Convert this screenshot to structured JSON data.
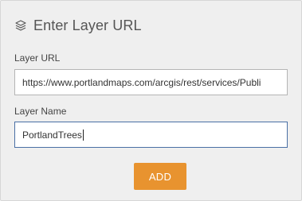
{
  "header": {
    "title": "Enter Layer URL",
    "icon": "layers-icon"
  },
  "form": {
    "url_label": "Layer URL",
    "url_value": "https://www.portlandmaps.com/arcgis/rest/services/Publi",
    "name_label": "Layer Name",
    "name_value": "PortlandTrees",
    "add_label": "ADD"
  },
  "colors": {
    "panel_bg": "#efefef",
    "accent_button": "#e8932f",
    "focus_border": "#4a6fa5"
  }
}
